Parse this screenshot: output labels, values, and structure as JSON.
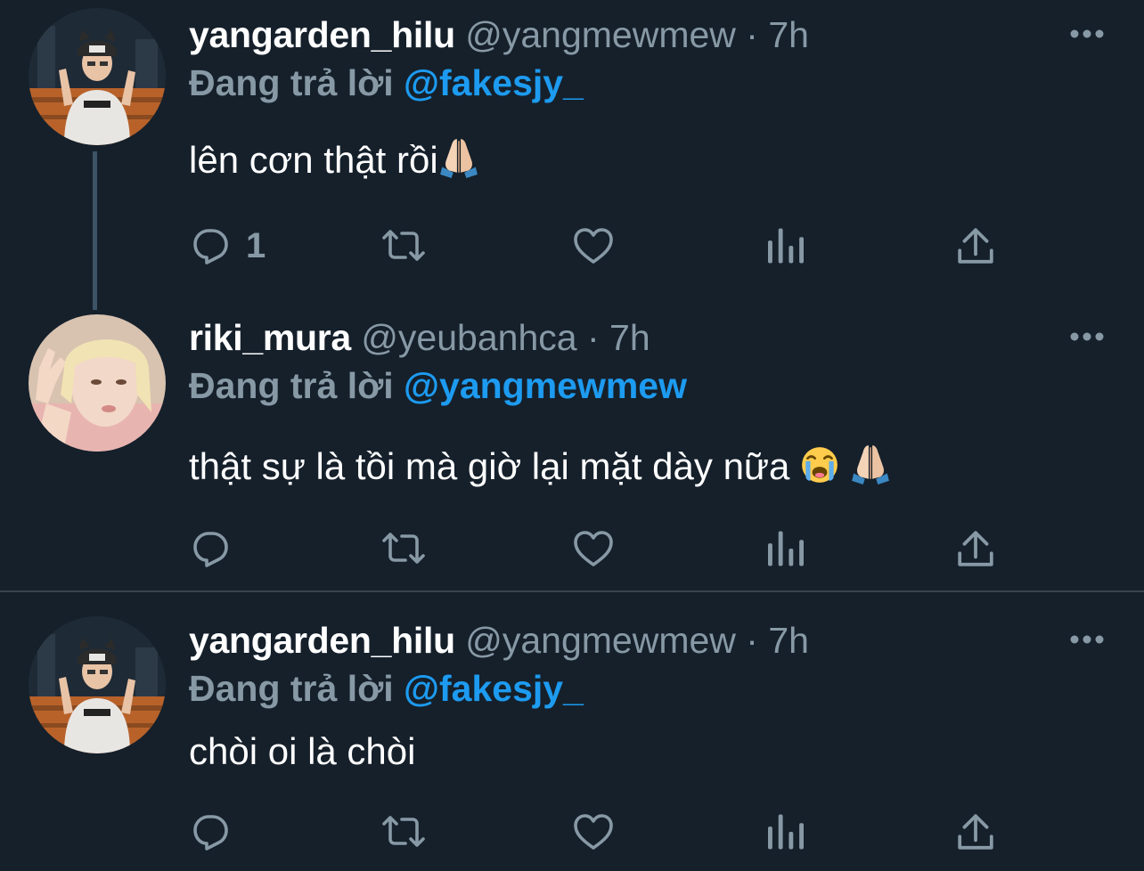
{
  "tweets": [
    {
      "display_name": "yangarden_hilu",
      "handle": "@yangmewmew",
      "separator": "·",
      "time": "7h",
      "replying_prefix": "Đang trả lời",
      "replying_to": "@fakesjy_",
      "text": "lên cơn thật rồi",
      "emojis": [
        "folded-hands"
      ],
      "reply_count": "1",
      "avatar_icon": "avatar-person-white-hoodie-cat-ear-hat"
    },
    {
      "display_name": "riki_mura",
      "handle": "@yeubanhca",
      "separator": "·",
      "time": "7h",
      "replying_prefix": "Đang trả lời",
      "replying_to": "@yangmewmew",
      "text": "thật sự là tồi mà giờ lại mặt dày nữa",
      "emojis": [
        "loudly-crying-face",
        "folded-hands"
      ],
      "reply_count": "",
      "avatar_icon": "avatar-blonde-person-peace-sign"
    },
    {
      "display_name": "yangarden_hilu",
      "handle": "@yangmewmew",
      "separator": "·",
      "time": "7h",
      "replying_prefix": "Đang trả lời",
      "replying_to": "@fakesjy_",
      "text": "chòi oi là chòi",
      "emojis": [],
      "reply_count": "",
      "avatar_icon": "avatar-person-white-hoodie-cat-ear-hat"
    }
  ],
  "icons": {
    "reply": "reply-icon",
    "retweet": "retweet-icon",
    "like": "like-icon",
    "analytics": "analytics-icon",
    "share": "share-icon",
    "more": "more-icon"
  },
  "colors": {
    "background": "#15202b",
    "text_primary": "#ffffff",
    "text_secondary": "#8899a6",
    "accent": "#1d9bf0",
    "divider": "#38444d",
    "thread_line": "#3d5466"
  }
}
